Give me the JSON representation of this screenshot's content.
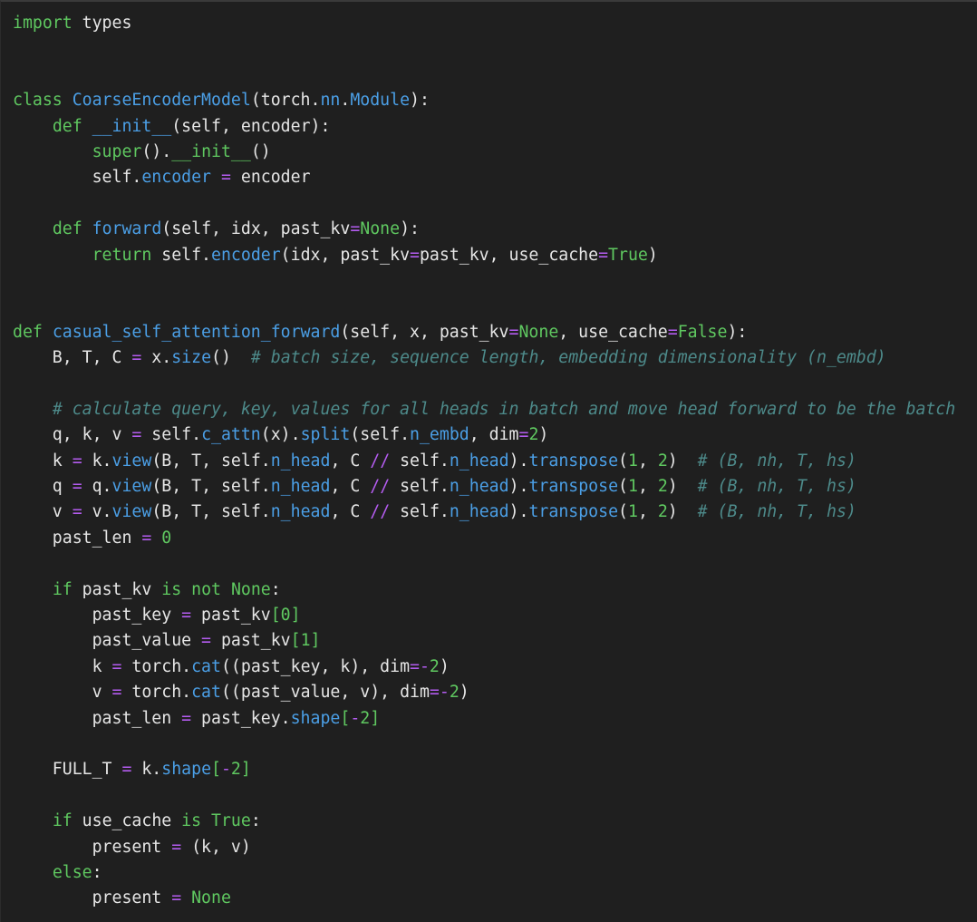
{
  "colors": {
    "background": "#1f1f1f",
    "text": "#e6e6e6",
    "keyword": "#5fc860",
    "function": "#4b9fe6",
    "operator": "#b45cf0",
    "number": "#5fc860",
    "comment": "#4d8a8a"
  },
  "lines": [
    [
      {
        "t": "kw",
        "s": "import"
      },
      {
        "t": "text",
        "s": " types"
      }
    ],
    [],
    [],
    [
      {
        "t": "kw",
        "s": "class"
      },
      {
        "t": "text",
        "s": " "
      },
      {
        "t": "cls",
        "s": "CoarseEncoderModel"
      },
      {
        "t": "text",
        "s": "(torch."
      },
      {
        "t": "attr",
        "s": "nn"
      },
      {
        "t": "text",
        "s": "."
      },
      {
        "t": "attr",
        "s": "Module"
      },
      {
        "t": "text",
        "s": "):"
      }
    ],
    [
      {
        "t": "text",
        "s": "    "
      },
      {
        "t": "kw",
        "s": "def"
      },
      {
        "t": "text",
        "s": " "
      },
      {
        "t": "fn",
        "s": "__init__"
      },
      {
        "t": "text",
        "s": "(self, encoder):"
      }
    ],
    [
      {
        "t": "text",
        "s": "        "
      },
      {
        "t": "kw",
        "s": "super"
      },
      {
        "t": "text",
        "s": "()."
      },
      {
        "t": "kw",
        "s": "__init__"
      },
      {
        "t": "text",
        "s": "()"
      }
    ],
    [
      {
        "t": "text",
        "s": "        self."
      },
      {
        "t": "attr",
        "s": "encoder"
      },
      {
        "t": "text",
        "s": " "
      },
      {
        "t": "op",
        "s": "="
      },
      {
        "t": "text",
        "s": " encoder"
      }
    ],
    [],
    [
      {
        "t": "text",
        "s": "    "
      },
      {
        "t": "kw",
        "s": "def"
      },
      {
        "t": "text",
        "s": " "
      },
      {
        "t": "fn",
        "s": "forward"
      },
      {
        "t": "text",
        "s": "(self, idx, past_kv"
      },
      {
        "t": "op",
        "s": "="
      },
      {
        "t": "kw",
        "s": "None"
      },
      {
        "t": "text",
        "s": "):"
      }
    ],
    [
      {
        "t": "text",
        "s": "        "
      },
      {
        "t": "kw",
        "s": "return"
      },
      {
        "t": "text",
        "s": " self."
      },
      {
        "t": "attr",
        "s": "encoder"
      },
      {
        "t": "text",
        "s": "(idx, past_kv"
      },
      {
        "t": "op",
        "s": "="
      },
      {
        "t": "text",
        "s": "past_kv, use_cache"
      },
      {
        "t": "op",
        "s": "="
      },
      {
        "t": "kw",
        "s": "True"
      },
      {
        "t": "text",
        "s": ")"
      }
    ],
    [],
    [],
    [
      {
        "t": "kw",
        "s": "def"
      },
      {
        "t": "text",
        "s": " "
      },
      {
        "t": "fn",
        "s": "casual_self_attention_forward"
      },
      {
        "t": "text",
        "s": "(self, x, past_kv"
      },
      {
        "t": "op",
        "s": "="
      },
      {
        "t": "kw",
        "s": "None"
      },
      {
        "t": "text",
        "s": ", use_cache"
      },
      {
        "t": "op",
        "s": "="
      },
      {
        "t": "kw",
        "s": "False"
      },
      {
        "t": "text",
        "s": "):"
      }
    ],
    [
      {
        "t": "text",
        "s": "    B, T, C "
      },
      {
        "t": "op",
        "s": "="
      },
      {
        "t": "text",
        "s": " x."
      },
      {
        "t": "attr",
        "s": "size"
      },
      {
        "t": "text",
        "s": "()  "
      },
      {
        "t": "cmt",
        "s": "# batch size, sequence length, embedding dimensionality (n_embd)"
      }
    ],
    [],
    [
      {
        "t": "text",
        "s": "    "
      },
      {
        "t": "cmt",
        "s": "# calculate query, key, values for all heads in batch and move head forward to be the batch"
      }
    ],
    [
      {
        "t": "text",
        "s": "    q, k, v "
      },
      {
        "t": "op",
        "s": "="
      },
      {
        "t": "text",
        "s": " self."
      },
      {
        "t": "attr",
        "s": "c_attn"
      },
      {
        "t": "text",
        "s": "(x)."
      },
      {
        "t": "attr",
        "s": "split"
      },
      {
        "t": "text",
        "s": "(self."
      },
      {
        "t": "attr",
        "s": "n_embd"
      },
      {
        "t": "text",
        "s": ", dim"
      },
      {
        "t": "op",
        "s": "="
      },
      {
        "t": "num",
        "s": "2"
      },
      {
        "t": "text",
        "s": ")"
      }
    ],
    [
      {
        "t": "text",
        "s": "    k "
      },
      {
        "t": "op",
        "s": "="
      },
      {
        "t": "text",
        "s": " k."
      },
      {
        "t": "attr",
        "s": "view"
      },
      {
        "t": "text",
        "s": "(B, T, self."
      },
      {
        "t": "attr",
        "s": "n_head"
      },
      {
        "t": "text",
        "s": ", C "
      },
      {
        "t": "op",
        "s": "//"
      },
      {
        "t": "text",
        "s": " self."
      },
      {
        "t": "attr",
        "s": "n_head"
      },
      {
        "t": "text",
        "s": ")."
      },
      {
        "t": "attr",
        "s": "transpose"
      },
      {
        "t": "text",
        "s": "("
      },
      {
        "t": "num",
        "s": "1"
      },
      {
        "t": "text",
        "s": ", "
      },
      {
        "t": "num",
        "s": "2"
      },
      {
        "t": "text",
        "s": ")  "
      },
      {
        "t": "cmt",
        "s": "# (B, nh, T, hs)"
      }
    ],
    [
      {
        "t": "text",
        "s": "    q "
      },
      {
        "t": "op",
        "s": "="
      },
      {
        "t": "text",
        "s": " q."
      },
      {
        "t": "attr",
        "s": "view"
      },
      {
        "t": "text",
        "s": "(B, T, self."
      },
      {
        "t": "attr",
        "s": "n_head"
      },
      {
        "t": "text",
        "s": ", C "
      },
      {
        "t": "op",
        "s": "//"
      },
      {
        "t": "text",
        "s": " self."
      },
      {
        "t": "attr",
        "s": "n_head"
      },
      {
        "t": "text",
        "s": ")."
      },
      {
        "t": "attr",
        "s": "transpose"
      },
      {
        "t": "text",
        "s": "("
      },
      {
        "t": "num",
        "s": "1"
      },
      {
        "t": "text",
        "s": ", "
      },
      {
        "t": "num",
        "s": "2"
      },
      {
        "t": "text",
        "s": ")  "
      },
      {
        "t": "cmt",
        "s": "# (B, nh, T, hs)"
      }
    ],
    [
      {
        "t": "text",
        "s": "    v "
      },
      {
        "t": "op",
        "s": "="
      },
      {
        "t": "text",
        "s": " v."
      },
      {
        "t": "attr",
        "s": "view"
      },
      {
        "t": "text",
        "s": "(B, T, self."
      },
      {
        "t": "attr",
        "s": "n_head"
      },
      {
        "t": "text",
        "s": ", C "
      },
      {
        "t": "op",
        "s": "//"
      },
      {
        "t": "text",
        "s": " self."
      },
      {
        "t": "attr",
        "s": "n_head"
      },
      {
        "t": "text",
        "s": ")."
      },
      {
        "t": "attr",
        "s": "transpose"
      },
      {
        "t": "text",
        "s": "("
      },
      {
        "t": "num",
        "s": "1"
      },
      {
        "t": "text",
        "s": ", "
      },
      {
        "t": "num",
        "s": "2"
      },
      {
        "t": "text",
        "s": ")  "
      },
      {
        "t": "cmt",
        "s": "# (B, nh, T, hs)"
      }
    ],
    [
      {
        "t": "text",
        "s": "    past_len "
      },
      {
        "t": "op",
        "s": "="
      },
      {
        "t": "text",
        "s": " "
      },
      {
        "t": "num",
        "s": "0"
      }
    ],
    [],
    [
      {
        "t": "text",
        "s": "    "
      },
      {
        "t": "kw",
        "s": "if"
      },
      {
        "t": "text",
        "s": " past_kv "
      },
      {
        "t": "kw",
        "s": "is"
      },
      {
        "t": "text",
        "s": " "
      },
      {
        "t": "kw",
        "s": "not"
      },
      {
        "t": "text",
        "s": " "
      },
      {
        "t": "kw",
        "s": "None"
      },
      {
        "t": "text",
        "s": ":"
      }
    ],
    [
      {
        "t": "text",
        "s": "        past_key "
      },
      {
        "t": "op",
        "s": "="
      },
      {
        "t": "text",
        "s": " past_kv"
      },
      {
        "t": "br",
        "s": "["
      },
      {
        "t": "num",
        "s": "0"
      },
      {
        "t": "br",
        "s": "]"
      }
    ],
    [
      {
        "t": "text",
        "s": "        past_value "
      },
      {
        "t": "op",
        "s": "="
      },
      {
        "t": "text",
        "s": " past_kv"
      },
      {
        "t": "br",
        "s": "["
      },
      {
        "t": "num",
        "s": "1"
      },
      {
        "t": "br",
        "s": "]"
      }
    ],
    [
      {
        "t": "text",
        "s": "        k "
      },
      {
        "t": "op",
        "s": "="
      },
      {
        "t": "text",
        "s": " torch."
      },
      {
        "t": "attr",
        "s": "cat"
      },
      {
        "t": "text",
        "s": "((past_key, k), dim"
      },
      {
        "t": "op",
        "s": "=-"
      },
      {
        "t": "num",
        "s": "2"
      },
      {
        "t": "text",
        "s": ")"
      }
    ],
    [
      {
        "t": "text",
        "s": "        v "
      },
      {
        "t": "op",
        "s": "="
      },
      {
        "t": "text",
        "s": " torch."
      },
      {
        "t": "attr",
        "s": "cat"
      },
      {
        "t": "text",
        "s": "((past_value, v), dim"
      },
      {
        "t": "op",
        "s": "=-"
      },
      {
        "t": "num",
        "s": "2"
      },
      {
        "t": "text",
        "s": ")"
      }
    ],
    [
      {
        "t": "text",
        "s": "        past_len "
      },
      {
        "t": "op",
        "s": "="
      },
      {
        "t": "text",
        "s": " past_key."
      },
      {
        "t": "attr",
        "s": "shape"
      },
      {
        "t": "br",
        "s": "["
      },
      {
        "t": "op",
        "s": "-"
      },
      {
        "t": "num",
        "s": "2"
      },
      {
        "t": "br",
        "s": "]"
      }
    ],
    [],
    [
      {
        "t": "text",
        "s": "    FULL_T "
      },
      {
        "t": "op",
        "s": "="
      },
      {
        "t": "text",
        "s": " k."
      },
      {
        "t": "attr",
        "s": "shape"
      },
      {
        "t": "br",
        "s": "["
      },
      {
        "t": "op",
        "s": "-"
      },
      {
        "t": "num",
        "s": "2"
      },
      {
        "t": "br",
        "s": "]"
      }
    ],
    [],
    [
      {
        "t": "text",
        "s": "    "
      },
      {
        "t": "kw",
        "s": "if"
      },
      {
        "t": "text",
        "s": " use_cache "
      },
      {
        "t": "kw",
        "s": "is"
      },
      {
        "t": "text",
        "s": " "
      },
      {
        "t": "kw",
        "s": "True"
      },
      {
        "t": "text",
        "s": ":"
      }
    ],
    [
      {
        "t": "text",
        "s": "        present "
      },
      {
        "t": "op",
        "s": "="
      },
      {
        "t": "text",
        "s": " (k, v)"
      }
    ],
    [
      {
        "t": "text",
        "s": "    "
      },
      {
        "t": "kw",
        "s": "else"
      },
      {
        "t": "text",
        "s": ":"
      }
    ],
    [
      {
        "t": "text",
        "s": "        present "
      },
      {
        "t": "op",
        "s": "="
      },
      {
        "t": "text",
        "s": " "
      },
      {
        "t": "kw",
        "s": "None"
      }
    ]
  ]
}
